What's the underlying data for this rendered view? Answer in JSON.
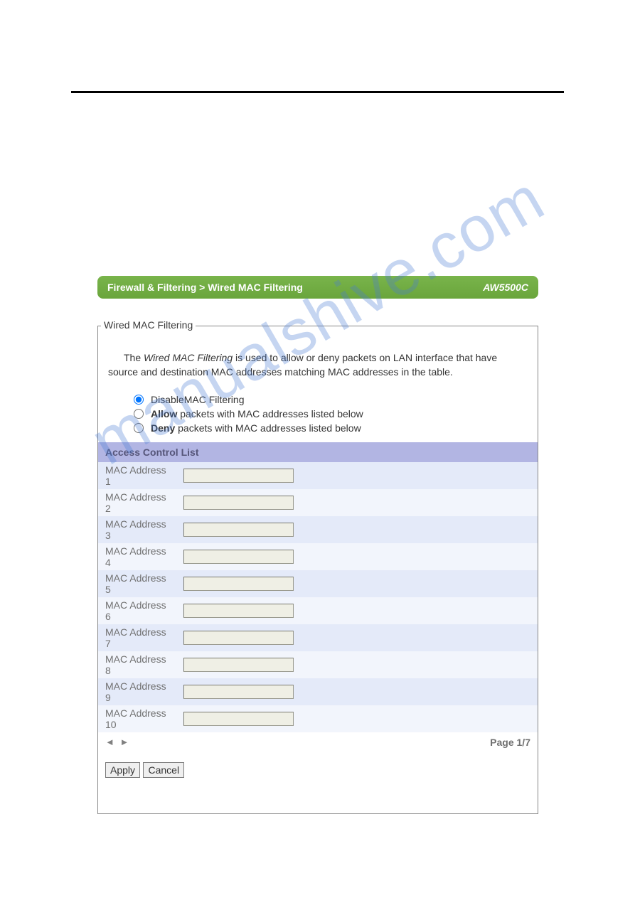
{
  "watermark": "manualshive.com",
  "breadcrumb": {
    "path": "Firewall & Filtering > Wired MAC Filtering",
    "model": "AW5500C"
  },
  "fieldset": {
    "legend": "Wired MAC Filtering",
    "description_prefix": "The ",
    "description_em": "Wired MAC Filtering",
    "description_suffix": " is used to allow or deny packets on LAN interface that have source and destination MAC addresses matching MAC addresses in the table.",
    "radios": {
      "disable": "DisableMAC Filtering",
      "allow_bold": "Allow",
      "allow_rest": " packets with MAC addresses listed below",
      "deny_bold": "Deny",
      "deny_rest": " packets with MAC addresses listed below"
    },
    "acl": {
      "header": "Access Control List",
      "rows": [
        {
          "label": "MAC Address 1",
          "value": ""
        },
        {
          "label": "MAC Address 2",
          "value": ""
        },
        {
          "label": "MAC Address 3",
          "value": ""
        },
        {
          "label": "MAC Address 4",
          "value": ""
        },
        {
          "label": "MAC Address 5",
          "value": ""
        },
        {
          "label": "MAC Address 6",
          "value": ""
        },
        {
          "label": "MAC Address 7",
          "value": ""
        },
        {
          "label": "MAC Address 8",
          "value": ""
        },
        {
          "label": "MAC Address 9",
          "value": ""
        },
        {
          "label": "MAC Address 10",
          "value": ""
        }
      ]
    },
    "pager": {
      "arrows": "◄ ►",
      "text": "Page 1/7"
    },
    "buttons": {
      "apply": "Apply",
      "cancel": "Cancel"
    }
  }
}
